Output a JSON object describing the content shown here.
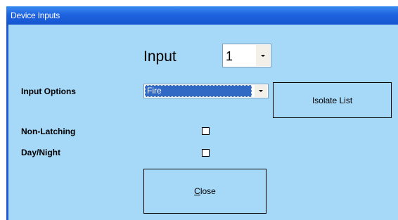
{
  "window": {
    "title": "Device Inputs"
  },
  "input": {
    "label": "Input",
    "selected_value": "1"
  },
  "input_options": {
    "label": "Input Options",
    "selected_value": "Fire"
  },
  "buttons": {
    "isolate_list": "Isolate List",
    "close": "Close"
  },
  "options": {
    "non_latching": {
      "label": "Non-Latching",
      "checked": false
    },
    "day_night": {
      "label": "Day/Night",
      "checked": false
    }
  },
  "colors": {
    "window_background": "#a6d8f8",
    "titlebar": "#1f63e0",
    "selection": "#316ac5"
  }
}
